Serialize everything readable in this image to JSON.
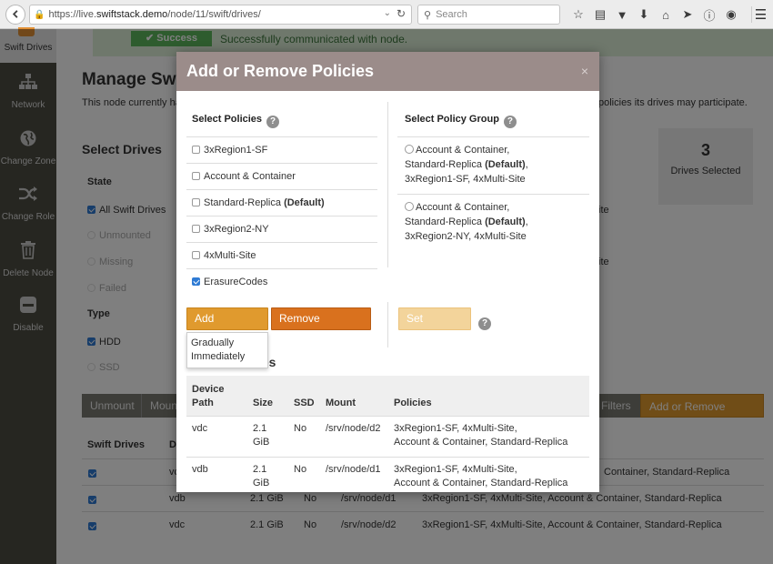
{
  "browser": {
    "url_prefix": "https://live.",
    "url_domain": "swiftstack.demo",
    "url_path": "/node/11/swift/drives/",
    "search_placeholder": "Search"
  },
  "sidebar": {
    "items": [
      {
        "label": "Swift Drives",
        "icon": "hard-drive-icon"
      },
      {
        "label": "Network",
        "icon": "network-icon"
      },
      {
        "label": "Change Zone",
        "icon": "globe-icon"
      },
      {
        "label": "Change Role",
        "icon": "shuffle-icon"
      },
      {
        "label": "Delete Node",
        "icon": "trash-icon"
      },
      {
        "label": "Disable",
        "icon": "minus-icon"
      }
    ]
  },
  "page": {
    "success_badge": "✔ Success",
    "success_msg": "Successfully communicated with node.",
    "title": "Manage Swi",
    "desc": "This node currently ha",
    "desc_right": "policies its drives may participate.",
    "select_drives": "Select Drives",
    "state_header": "State",
    "state_items": [
      "All Swift Drives",
      "Unmounted",
      "Missing",
      "Failed"
    ],
    "type_header": "Type",
    "type_items": [
      "HDD",
      "SSD"
    ],
    "drives_count": "3",
    "drives_label": "Drives Selected",
    "right_frags": [
      "ite",
      "ite"
    ],
    "buttons": {
      "unmount": "Unmount",
      "mount": "Moun",
      "filters": "Filters",
      "add_remove": "Add or Remove Policies"
    },
    "table_headers": {
      "swift_drives": "Swift Drives",
      "device": "D"
    },
    "rows": [
      {
        "device": "vc",
        "size": "",
        "ssd": "",
        "mount": "",
        "policies": "Container, Standard-Replica"
      },
      {
        "device": "vdb",
        "size": "2.1 GiB",
        "ssd": "No",
        "mount": "/srv/node/d1",
        "policies": "3xRegion1-SF, 4xMulti-Site, Account & Container, Standard-Replica"
      },
      {
        "device": "vdc",
        "size": "2.1 GiB",
        "ssd": "No",
        "mount": "/srv/node/d2",
        "policies": "3xRegion1-SF, 4xMulti-Site, Account & Container, Standard-Replica"
      }
    ]
  },
  "modal": {
    "title": "Add or Remove Policies",
    "close": "×",
    "select_policies": "Select Policies",
    "select_group": "Select Policy Group",
    "policies": [
      {
        "name": "3xRegion1-SF",
        "suffix": "",
        "checked": false
      },
      {
        "name": "Account & Container",
        "suffix": "",
        "checked": false
      },
      {
        "name": "Standard-Replica ",
        "suffix": "(Default)",
        "checked": false
      },
      {
        "name": "3xRegion2-NY",
        "suffix": "",
        "checked": false
      },
      {
        "name": "4xMulti-Site",
        "suffix": "",
        "checked": false
      },
      {
        "name": "ErasureCodes",
        "suffix": "",
        "checked": true
      }
    ],
    "groups": [
      {
        "l1": "Account & Container,",
        "l2a": "Standard-Replica ",
        "l2b": "(Default)",
        "l2c": ",",
        "l3": "3xRegion1-SF, 4xMulti-Site"
      },
      {
        "l1": "Account & Container,",
        "l2a": "Standard-Replica ",
        "l2b": "(Default)",
        "l2c": ",",
        "l3": "3xRegion2-NY, 4xMulti-Site"
      }
    ],
    "add_policies": "Add Policies",
    "remove_policies": "Remove Policies",
    "set_group": "Set Group",
    "dropdown": [
      "Gradually",
      "Immediately"
    ],
    "subtitle": "ies",
    "table_headers": {
      "device_path_1": "Device",
      "device_path_2": "Path",
      "size": "Size",
      "ssd": "SSD",
      "mount": "Mount",
      "policies": "Policies"
    },
    "rows": [
      {
        "path": "vdc",
        "size1": "2.1",
        "size2": "GiB",
        "ssd": "No",
        "mount": "/srv/node/d2",
        "pol1": "3xRegion1-SF, 4xMulti-Site,",
        "pol2": "Account & Container, Standard-Replica"
      },
      {
        "path": "vdb",
        "size1": "2.1",
        "size2": "GiB",
        "ssd": "No",
        "mount": "/srv/node/d1",
        "pol1": "3xRegion1-SF, 4xMulti-Site,",
        "pol2": "Account & Container, Standard-Replica"
      }
    ]
  },
  "colors": {
    "accent_orange": "#e09a2e",
    "remove_orange": "#d9711e",
    "success_green": "#5cb85c",
    "modal_head": "#9b8c8a",
    "sidebar": "#4c4c43"
  }
}
